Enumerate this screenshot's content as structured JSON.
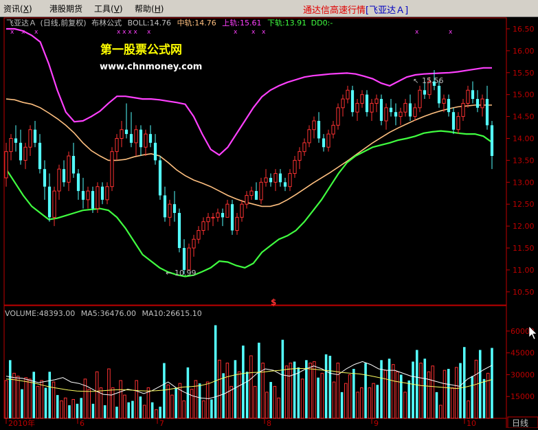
{
  "menu": {
    "items": [
      {
        "label": "资讯",
        "key": "X"
      },
      {
        "label": "港股期货",
        "key": ""
      },
      {
        "label": "工具",
        "key": "V"
      },
      {
        "label": "帮助",
        "key": "H"
      }
    ]
  },
  "app_title": {
    "prefix": "通达信高速行情",
    "symbol": "[飞亚达Ａ]"
  },
  "indicator_bar": {
    "stock": "飞亚达Ａ",
    "mode": "(日线,前复权)",
    "indicator": "布林公式",
    "boll": "BOLL:14.76",
    "mid": "中轨:14.76",
    "upper": "上轨:15.61",
    "lower": "下轨:13.91",
    "dd": "DD0:-"
  },
  "watermark": {
    "title": "第一股票公式网",
    "url": "www.chnmoney.com"
  },
  "annotations": {
    "high": "15.56",
    "low": "10.99",
    "marker": "$"
  },
  "volume_bar": {
    "volume": "VOLUME:48393.00",
    "ma5": "MA5:36476.00",
    "ma10": "MA10:26615.10"
  },
  "date_axis": {
    "labels": [
      "2010年",
      "6",
      "7",
      "8",
      "9",
      "10"
    ]
  },
  "period_label": "日线",
  "colors": {
    "up": "#ff3232",
    "down": "#54ffff",
    "boll_mid": "#ffc080",
    "boll_upper": "#ff40ff",
    "boll_lower": "#40ff40",
    "axis": "#c00000",
    "watermark_title": "#ffff00",
    "watermark_url": "#ffffff"
  },
  "chart_data": [
    {
      "type": "candlestick",
      "title": "飞亚达Ａ (日线,前复权) 布林公式",
      "ylim": [
        10.2,
        16.75
      ],
      "y_ticks": [
        10.5,
        11.0,
        11.5,
        12.0,
        12.5,
        13.0,
        13.5,
        14.0,
        14.5,
        15.0,
        15.5,
        16.0,
        16.5
      ],
      "ohlc": [
        [
          13.1,
          13.9,
          12.9,
          13.7
        ],
        [
          13.7,
          14.1,
          13.5,
          14.0
        ],
        [
          14.0,
          14.3,
          13.7,
          13.9
        ],
        [
          13.9,
          14.2,
          13.4,
          13.5
        ],
        [
          13.5,
          13.9,
          13.3,
          13.8
        ],
        [
          13.8,
          14.3,
          13.6,
          14.2
        ],
        [
          14.2,
          14.4,
          13.8,
          13.9
        ],
        [
          13.9,
          14.1,
          13.2,
          13.3
        ],
        [
          13.3,
          13.5,
          12.6,
          12.9
        ],
        [
          12.9,
          13.2,
          12.1,
          12.2
        ],
        [
          12.2,
          12.9,
          12.0,
          12.8
        ],
        [
          12.8,
          13.4,
          12.6,
          13.3
        ],
        [
          13.3,
          13.5,
          12.9,
          13.0
        ],
        [
          13.0,
          13.7,
          12.8,
          13.6
        ],
        [
          13.6,
          13.9,
          13.1,
          13.2
        ],
        [
          13.2,
          13.3,
          12.6,
          12.8
        ],
        [
          12.8,
          13.1,
          12.4,
          12.6
        ],
        [
          12.6,
          12.9,
          12.4,
          12.8
        ],
        [
          12.8,
          12.9,
          12.3,
          12.4
        ],
        [
          12.4,
          13.0,
          12.3,
          12.9
        ],
        [
          12.9,
          13.0,
          12.5,
          12.6
        ],
        [
          12.6,
          13.0,
          12.5,
          12.9
        ],
        [
          12.9,
          13.8,
          12.8,
          13.7
        ],
        [
          13.7,
          14.1,
          13.5,
          14.0
        ],
        [
          14.0,
          14.4,
          13.8,
          14.2
        ],
        [
          14.2,
          14.8,
          14.0,
          14.1
        ],
        [
          14.1,
          14.6,
          13.8,
          13.9
        ],
        [
          13.9,
          14.3,
          13.6,
          14.2
        ],
        [
          14.2,
          14.3,
          13.6,
          13.8
        ],
        [
          13.8,
          14.2,
          13.6,
          14.1
        ],
        [
          14.1,
          14.3,
          13.8,
          13.9
        ],
        [
          13.9,
          14.1,
          13.4,
          13.5
        ],
        [
          13.5,
          13.6,
          12.6,
          12.7
        ],
        [
          12.7,
          12.9,
          12.1,
          12.2
        ],
        [
          12.2,
          12.6,
          12.0,
          12.5
        ],
        [
          12.5,
          12.8,
          12.1,
          12.3
        ],
        [
          12.3,
          12.4,
          11.4,
          11.5
        ],
        [
          11.5,
          11.7,
          10.9,
          11.0
        ],
        [
          11.0,
          11.6,
          10.99,
          11.5
        ],
        [
          11.5,
          11.8,
          11.3,
          11.7
        ],
        [
          11.7,
          12.0,
          11.6,
          11.9
        ],
        [
          11.9,
          12.2,
          11.8,
          12.1
        ],
        [
          12.1,
          12.3,
          11.9,
          12.2
        ],
        [
          12.2,
          12.3,
          12.0,
          12.2
        ],
        [
          12.2,
          12.4,
          12.1,
          12.3
        ],
        [
          12.3,
          12.4,
          12.0,
          12.2
        ],
        [
          12.2,
          12.6,
          12.2,
          12.5
        ],
        [
          12.5,
          12.6,
          11.8,
          11.9
        ],
        [
          11.9,
          12.3,
          11.8,
          12.2
        ],
        [
          12.2,
          12.6,
          12.1,
          12.5
        ],
        [
          12.5,
          12.8,
          12.4,
          12.7
        ],
        [
          12.7,
          12.9,
          12.6,
          12.8
        ],
        [
          12.8,
          13.0,
          12.7,
          12.6
        ],
        [
          12.6,
          13.1,
          12.5,
          13.0
        ],
        [
          13.0,
          13.3,
          12.9,
          13.1
        ],
        [
          13.1,
          13.2,
          12.9,
          13.0
        ],
        [
          13.0,
          13.3,
          12.8,
          13.2
        ],
        [
          13.2,
          13.3,
          12.9,
          13.0
        ],
        [
          13.0,
          13.1,
          12.8,
          12.9
        ],
        [
          12.9,
          13.3,
          12.8,
          13.2
        ],
        [
          13.2,
          13.6,
          13.1,
          13.5
        ],
        [
          13.5,
          13.8,
          13.3,
          13.7
        ],
        [
          13.7,
          14.0,
          13.6,
          13.9
        ],
        [
          13.9,
          14.3,
          13.8,
          14.2
        ],
        [
          14.2,
          14.5,
          14.0,
          14.4
        ],
        [
          14.4,
          14.6,
          13.9,
          14.0
        ],
        [
          14.0,
          14.1,
          13.7,
          13.8
        ],
        [
          13.8,
          14.2,
          13.7,
          14.1
        ],
        [
          14.1,
          14.4,
          14.0,
          14.3
        ],
        [
          14.3,
          14.8,
          14.2,
          14.7
        ],
        [
          14.7,
          15.0,
          14.5,
          14.9
        ],
        [
          14.9,
          15.2,
          14.8,
          15.1
        ],
        [
          15.1,
          15.2,
          14.5,
          14.6
        ],
        [
          14.6,
          14.9,
          14.4,
          14.8
        ],
        [
          14.8,
          15.1,
          14.7,
          15.0
        ],
        [
          15.0,
          15.1,
          14.5,
          14.6
        ],
        [
          14.6,
          14.9,
          14.4,
          14.8
        ],
        [
          14.8,
          15.0,
          14.6,
          14.9
        ],
        [
          14.9,
          15.0,
          14.3,
          14.4
        ],
        [
          14.4,
          14.8,
          14.2,
          14.7
        ],
        [
          14.7,
          14.9,
          14.5,
          14.6
        ],
        [
          14.6,
          14.8,
          14.3,
          14.5
        ],
        [
          14.5,
          14.7,
          14.3,
          14.6
        ],
        [
          14.6,
          14.9,
          14.5,
          14.8
        ],
        [
          14.8,
          15.0,
          14.4,
          14.5
        ],
        [
          14.5,
          14.8,
          14.4,
          14.7
        ],
        [
          14.7,
          15.2,
          14.6,
          15.1
        ],
        [
          15.1,
          15.3,
          14.9,
          15.0
        ],
        [
          15.0,
          15.4,
          14.9,
          15.3
        ],
        [
          15.3,
          15.56,
          15.1,
          15.2
        ],
        [
          15.2,
          15.3,
          14.7,
          14.8
        ],
        [
          14.8,
          15.0,
          14.6,
          14.9
        ],
        [
          14.9,
          15.0,
          14.5,
          14.6
        ],
        [
          14.6,
          14.7,
          14.1,
          14.2
        ],
        [
          14.2,
          14.6,
          14.1,
          14.5
        ],
        [
          14.5,
          14.9,
          14.4,
          14.8
        ],
        [
          14.8,
          15.2,
          14.7,
          15.1
        ],
        [
          15.1,
          15.3,
          14.8,
          14.9
        ],
        [
          14.9,
          15.1,
          14.6,
          14.7
        ],
        [
          14.7,
          15.0,
          14.5,
          14.9
        ],
        [
          14.9,
          15.2,
          14.2,
          14.3
        ],
        [
          14.3,
          14.4,
          13.3,
          13.6
        ]
      ],
      "series": [
        {
          "name": "中轨",
          "values": [
            14.9,
            14.88,
            14.82,
            14.78,
            14.7,
            14.58,
            14.45,
            14.3,
            14.12,
            13.9,
            13.72,
            13.6,
            13.5,
            13.5,
            13.52,
            13.58,
            13.62,
            13.65,
            13.6,
            13.45,
            13.28,
            13.15,
            13.05,
            12.98,
            12.9,
            12.8,
            12.7,
            12.62,
            12.55,
            12.5,
            12.45,
            12.45,
            12.5,
            12.6,
            12.72,
            12.85,
            12.98,
            13.1,
            13.22,
            13.35,
            13.48,
            13.62,
            13.76,
            13.9,
            14.02,
            14.14,
            14.24,
            14.33,
            14.42,
            14.5,
            14.57,
            14.63,
            14.68,
            14.72,
            14.74,
            14.76,
            14.76,
            14.76
          ]
        },
        {
          "name": "上轨",
          "values": [
            16.5,
            16.5,
            16.45,
            16.35,
            16.2,
            15.7,
            15.1,
            14.6,
            14.38,
            14.4,
            14.5,
            14.62,
            14.8,
            14.96,
            14.96,
            14.93,
            14.9,
            14.9,
            14.88,
            14.85,
            14.82,
            14.78,
            14.5,
            14.1,
            13.75,
            13.62,
            13.8,
            14.1,
            14.4,
            14.7,
            14.95,
            15.1,
            15.2,
            15.28,
            15.34,
            15.4,
            15.43,
            15.45,
            15.47,
            15.48,
            15.49,
            15.47,
            15.42,
            15.36,
            15.26,
            15.2,
            15.3,
            15.4,
            15.45,
            15.47,
            15.48,
            15.49,
            15.5,
            15.52,
            15.55,
            15.58,
            15.61,
            15.61
          ]
        },
        {
          "name": "下轨",
          "values": [
            13.3,
            13.0,
            12.7,
            12.45,
            12.3,
            12.15,
            12.18,
            12.24,
            12.3,
            12.36,
            12.38,
            12.4,
            12.36,
            12.2,
            11.95,
            11.65,
            11.35,
            11.2,
            11.05,
            10.95,
            10.89,
            10.85,
            10.88,
            10.96,
            11.05,
            11.2,
            11.18,
            11.1,
            11.05,
            11.15,
            11.4,
            11.55,
            11.7,
            11.78,
            11.9,
            12.1,
            12.35,
            12.6,
            12.9,
            13.2,
            13.45,
            13.6,
            13.7,
            13.8,
            13.85,
            13.9,
            13.96,
            14.0,
            14.05,
            14.12,
            14.15,
            14.17,
            14.15,
            14.12,
            14.1,
            14.1,
            14.05,
            13.91
          ]
        }
      ]
    },
    {
      "type": "bar",
      "title": "VOLUME",
      "ylim": [
        0,
        68000
      ],
      "y_ticks": [
        15000,
        30000,
        45000,
        60000
      ],
      "values": [
        26000,
        40000,
        31000,
        29000,
        20000,
        28000,
        27000,
        32000,
        22000,
        26000,
        21000,
        32000,
        25000,
        16000,
        12000,
        14000,
        9000,
        13000,
        10000,
        14000,
        27000,
        20000,
        10000,
        32000,
        21000,
        9000,
        34000,
        21000,
        8000,
        26000,
        16000,
        11000,
        12000,
        26000,
        15000,
        9000,
        21000,
        11000,
        6000,
        8000,
        38000,
        23000,
        16000,
        21000,
        24000,
        12000,
        35000,
        20000,
        26000,
        24000,
        12000,
        25000,
        13000,
        64000,
        40000,
        31000,
        38000,
        22000,
        40000,
        32000,
        50000,
        32000,
        43000,
        22000,
        52000,
        38000,
        18000,
        25000,
        22000,
        14000,
        54000,
        36000,
        38000,
        39000,
        35000,
        27000,
        40000,
        38000,
        39000,
        28000,
        31000,
        44000,
        43000,
        25000,
        38000,
        18000,
        24000,
        30000,
        34000,
        18000,
        21000,
        38000,
        21000,
        24000,
        23000,
        40000,
        33000,
        41000,
        37000,
        32000,
        30000,
        18000,
        26000,
        39000,
        47000,
        38000,
        41000,
        32000,
        36000,
        18000,
        9000,
        33000,
        34000,
        21000,
        35000,
        38000,
        49000,
        12000,
        29000,
        40000,
        47000,
        27000,
        31000,
        48393
      ],
      "series": [
        {
          "name": "MA5",
          "values": [
            29000,
            28000,
            27500,
            26000,
            24500,
            25500,
            26500,
            28000,
            25000,
            24000,
            22000,
            19000,
            16500,
            16000,
            18000,
            20000,
            19000,
            17000,
            19000,
            22000,
            25000,
            21000,
            18000,
            15500,
            14000,
            13500,
            15000,
            17000,
            20000,
            23000,
            26000,
            31000,
            34000,
            33000,
            30000,
            29000,
            31000,
            34000,
            36000,
            34000,
            31000,
            30000,
            34000,
            37000,
            39000,
            37000,
            34000,
            33000,
            33000,
            31000,
            29000,
            28000,
            27000,
            25500,
            24000,
            23000,
            22000,
            27000,
            30000,
            33500,
            36476
          ]
        },
        {
          "name": "MA10",
          "values": [
            27000,
            26500,
            25500,
            24500,
            23000,
            21500,
            20500,
            19500,
            18800,
            18500,
            18500,
            19000,
            19500,
            19700,
            19500,
            19000,
            18800,
            19000,
            19500,
            20500,
            21500,
            21800,
            22500,
            24000,
            26500,
            28500,
            30000,
            31000,
            31500,
            31800,
            32500,
            33000,
            33800,
            34300,
            34200,
            33700,
            33000,
            32500,
            31500,
            31000,
            30500,
            29500,
            28300,
            27000,
            25500,
            24500,
            23500,
            22500,
            22000,
            21500,
            21000,
            20500,
            21500,
            23000,
            25000,
            26615.1
          ]
        }
      ]
    }
  ]
}
